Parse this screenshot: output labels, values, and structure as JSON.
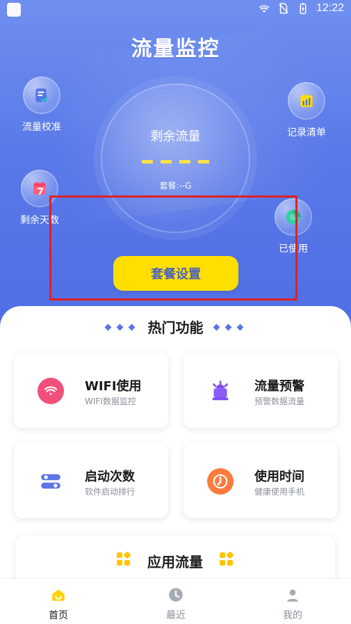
{
  "status_bar": {
    "time": "12:22"
  },
  "page": {
    "title": "流量监控"
  },
  "side_items": {
    "calibration": {
      "label": "流量校准"
    },
    "records": {
      "label": "记录清单"
    },
    "days_left": {
      "label": "剩余天数"
    },
    "used": {
      "label": "已使用"
    }
  },
  "bubble": {
    "title": "剩余流量",
    "value_placeholder": "----",
    "package_info": "套餐:--G"
  },
  "package_button": {
    "label": "套餐设置"
  },
  "hot": {
    "title": "热门功能",
    "cards": [
      {
        "title": "WIFI使用",
        "subtitle": "WIFI数据监控",
        "icon": "wifi-icon",
        "color": "#f0507a"
      },
      {
        "title": "流量预警",
        "subtitle": "预警数据流量",
        "icon": "alarm-light-icon",
        "color": "#8a5cf6"
      },
      {
        "title": "启动次数",
        "subtitle": "软件启动排行",
        "icon": "toggle-icon",
        "color": "#5b74e6"
      },
      {
        "title": "使用时间",
        "subtitle": "健康使用手机",
        "icon": "clock-icon",
        "color": "#ff7a3d"
      }
    ]
  },
  "app_flow": {
    "title": "应用流量"
  },
  "bottom_nav": {
    "items": [
      {
        "label": "首页",
        "active": true,
        "icon": "home-icon"
      },
      {
        "label": "最近",
        "active": false,
        "icon": "clock-icon"
      },
      {
        "label": "我的",
        "active": false,
        "icon": "user-icon"
      }
    ]
  },
  "colors": {
    "hero_top": "#6f8ff0",
    "hero_bottom": "#4f6ee3",
    "accent_yellow": "#ffdf00",
    "highlight": "#e02020"
  }
}
